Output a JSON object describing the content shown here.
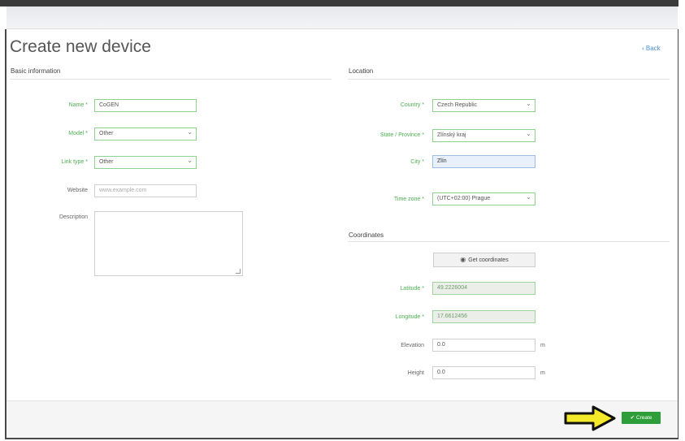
{
  "page": {
    "title": "Create new device",
    "back_label": "Back"
  },
  "basic": {
    "heading": "Basic information",
    "name": {
      "label": "Name *",
      "value": "CoGEN"
    },
    "model": {
      "label": "Model *",
      "value": "Other"
    },
    "link_type": {
      "label": "Link type *",
      "value": "Other"
    },
    "website": {
      "label": "Website",
      "placeholder": "www.example.com"
    },
    "description": {
      "label": "Description",
      "value": ""
    }
  },
  "location": {
    "heading": "Location",
    "country": {
      "label": "Country *",
      "value": "Czech Republic"
    },
    "state": {
      "label": "State / Province *",
      "value": "Zlínský kraj"
    },
    "city": {
      "label": "City *",
      "value": "Zlín"
    },
    "timezone": {
      "label": "Time zone *",
      "value": "(UTC+02:00) Prague"
    }
  },
  "coordinates": {
    "heading": "Coordinates",
    "get_button": "Get coordinates",
    "latitude": {
      "label": "Latitude *",
      "value": "49.2226004"
    },
    "longitude": {
      "label": "Longitude *",
      "value": "17.6612456"
    },
    "elevation": {
      "label": "Elevation",
      "value": "0.0",
      "unit": "m"
    },
    "height": {
      "label": "Height",
      "value": "0.0",
      "unit": "m"
    }
  },
  "footer": {
    "create_label": "Create",
    "accent_color": "#2e9e3a",
    "arrow_color": "#f5ea2a"
  }
}
